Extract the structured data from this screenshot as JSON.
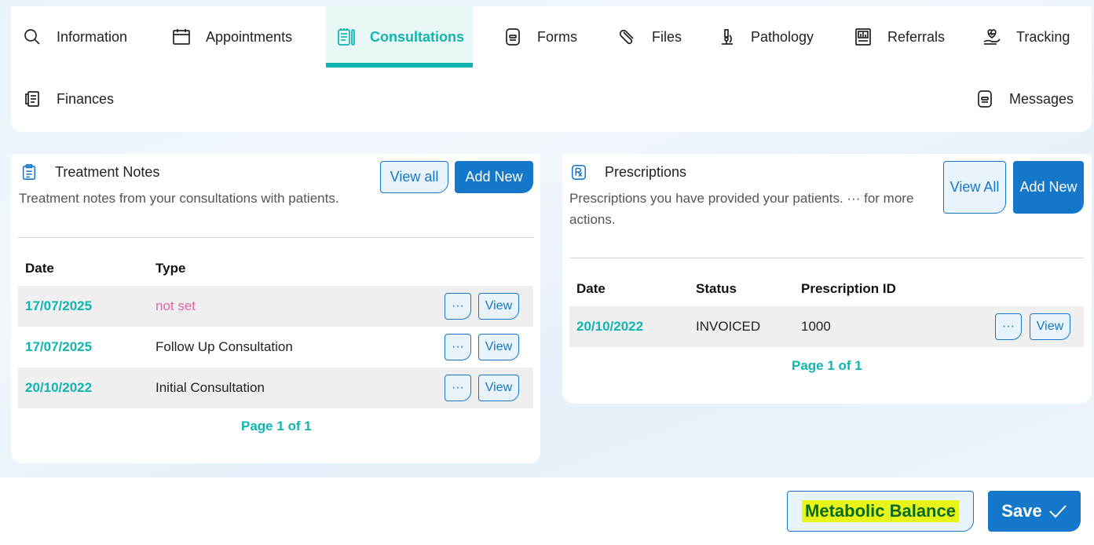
{
  "tabs": {
    "information": "Information",
    "appointments": "Appointments",
    "consultations": "Consultations",
    "forms": "Forms",
    "files": "Files",
    "pathology": "Pathology",
    "referrals": "Referrals",
    "tracking": "Tracking",
    "finances": "Finances",
    "messages": "Messages",
    "active": "Consultations"
  },
  "treatment_notes": {
    "title": "Treatment Notes",
    "description": "Treatment notes from your consultations with patients.",
    "view_all": "View all",
    "add_new": "Add New",
    "columns": [
      "Date",
      "Type"
    ],
    "rows": [
      {
        "date": "17/07/2025",
        "type": "not set",
        "more": "···",
        "view": "View"
      },
      {
        "date": "17/07/2025",
        "type": "Follow Up Consultation",
        "more": "···",
        "view": "View"
      },
      {
        "date": "20/10/2022",
        "type": "Initial Consultation",
        "more": "···",
        "view": "View"
      }
    ],
    "pager": "Page 1 of 1"
  },
  "prescriptions": {
    "title": "Prescriptions",
    "description": "Prescriptions you have provided your patients. ··· for more actions.",
    "view_all": "View All",
    "add_new": "Add New",
    "columns": [
      "Date",
      "Status",
      "Prescription ID"
    ],
    "rows": [
      {
        "date": "20/10/2022",
        "status": "INVOICED",
        "id": "1000",
        "more": "···",
        "view": "View"
      }
    ],
    "pager": "Page 1 of 1"
  },
  "footer": {
    "metabolic_balance": "Metabolic Balance",
    "save": "Save"
  },
  "colors": {
    "accent_teal": "#0fb5b0",
    "primary_blue": "#1577c9",
    "highlight": "#e8f51a"
  }
}
